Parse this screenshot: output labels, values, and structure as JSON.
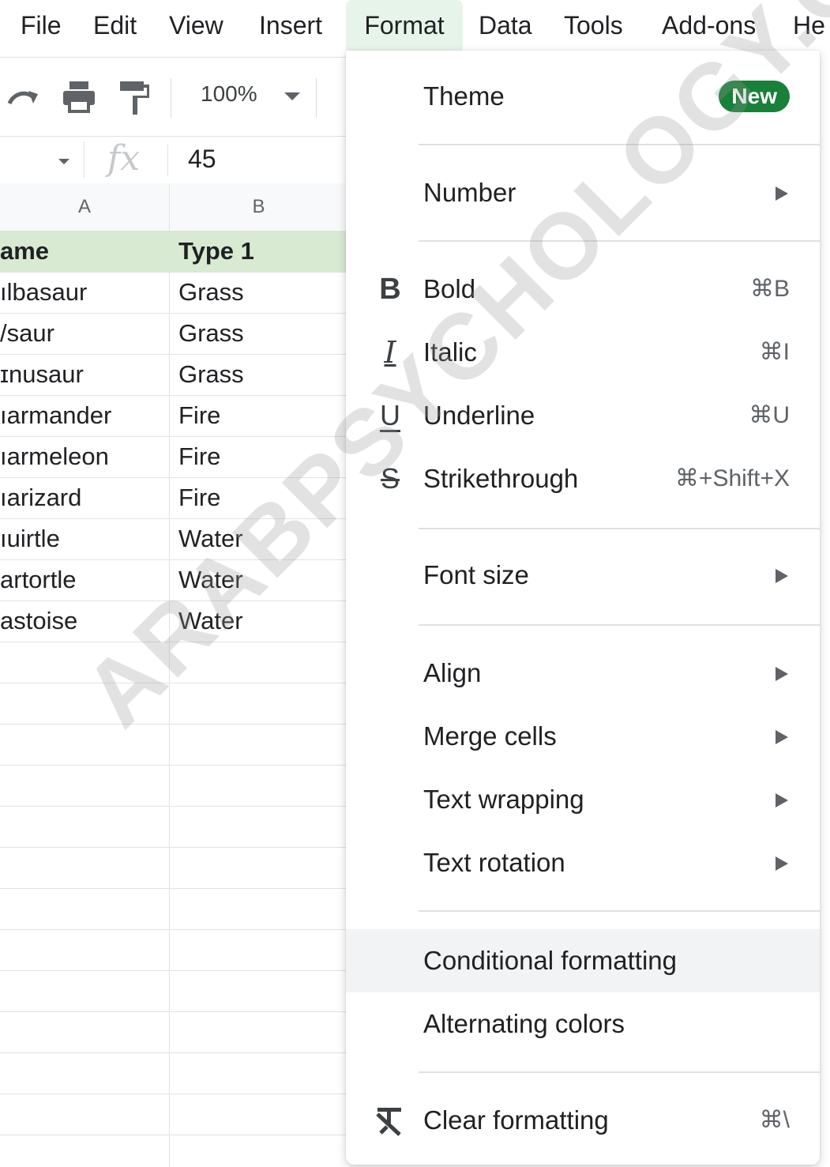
{
  "menubar": {
    "items": [
      "File",
      "Edit",
      "View",
      "Insert",
      "Format",
      "Data",
      "Tools",
      "Add-ons",
      "He"
    ],
    "active": "Format"
  },
  "toolbar": {
    "zoom": "100%"
  },
  "formula_bar": {
    "fx_symbol": "fx",
    "value": "45"
  },
  "sheet": {
    "columns": [
      "A",
      "B"
    ],
    "header_row": {
      "a": "ame",
      "b": "Type 1"
    },
    "rows": [
      {
        "a": "ılbasaur",
        "b": "Grass"
      },
      {
        "a": "/saur",
        "b": "Grass"
      },
      {
        "a": "ɪnusaur",
        "b": "Grass"
      },
      {
        "a": "ıarmander",
        "b": "Fire"
      },
      {
        "a": "ıarmeleon",
        "b": "Fire"
      },
      {
        "a": "ıarizard",
        "b": "Fire"
      },
      {
        "a": "ıuirtle",
        "b": "Water"
      },
      {
        "a": "artortle",
        "b": "Water"
      },
      {
        "a": "astoise",
        "b": "Water"
      }
    ],
    "header_color": "#d9ead3"
  },
  "format_menu": {
    "theme": {
      "label": "Theme",
      "badge": "New"
    },
    "number": {
      "label": "Number"
    },
    "bold": {
      "label": "Bold",
      "shortcut": "⌘B"
    },
    "italic": {
      "label": "Italic",
      "shortcut": "⌘I"
    },
    "underline": {
      "label": "Underline",
      "shortcut": "⌘U"
    },
    "strikethrough": {
      "label": "Strikethrough",
      "shortcut": "⌘+Shift+X"
    },
    "font_size": {
      "label": "Font size"
    },
    "align": {
      "label": "Align"
    },
    "merge_cells": {
      "label": "Merge cells"
    },
    "text_wrapping": {
      "label": "Text wrapping"
    },
    "text_rotation": {
      "label": "Text rotation"
    },
    "conditional_formatting": {
      "label": "Conditional formatting"
    },
    "alternating_colors": {
      "label": "Alternating colors"
    },
    "clear_formatting": {
      "label": "Clear formatting",
      "shortcut": "⌘\\"
    }
  },
  "icons": {
    "bold": "B",
    "italic": "I",
    "underline": "U",
    "strikethrough": "S"
  },
  "watermark": "ARABPSYCHOLOGY.CO",
  "colors": {
    "badge": "#188038",
    "menu_active": "#e6f4ea",
    "hover": "#f1f3f4"
  }
}
